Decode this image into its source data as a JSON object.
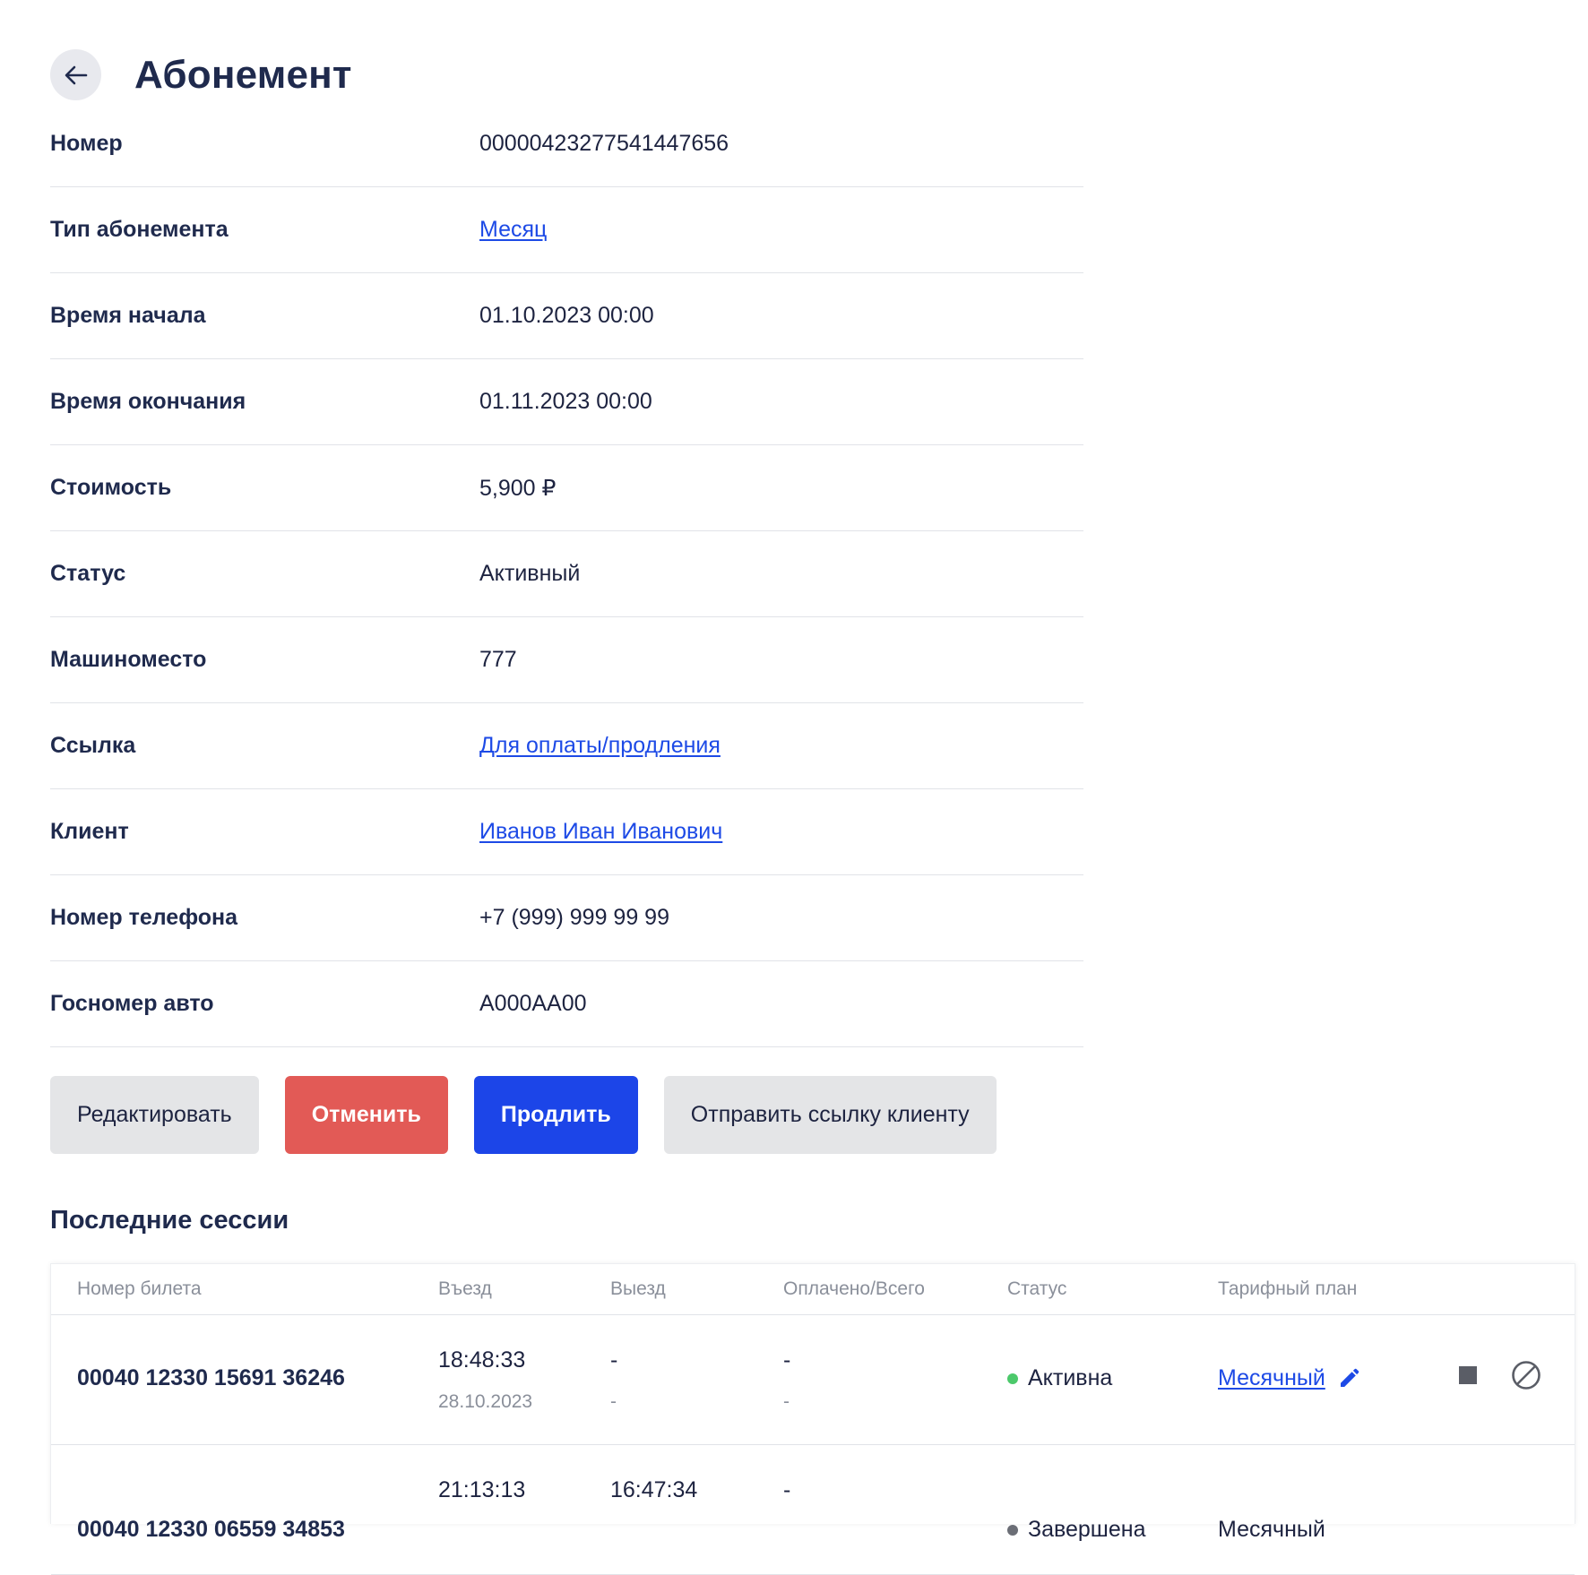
{
  "header": {
    "title": "Абонемент"
  },
  "details": [
    {
      "label": "Номер",
      "value": "00000423277541447656",
      "link": false
    },
    {
      "label": "Тип абонемента",
      "value": "Месяц",
      "link": true
    },
    {
      "label": "Время начала",
      "value": "01.10.2023 00:00",
      "link": false
    },
    {
      "label": "Время окончания",
      "value": "01.11.2023 00:00",
      "link": false
    },
    {
      "label": "Стоимость",
      "value": "5,900 ₽",
      "link": false
    },
    {
      "label": "Статус",
      "value": "Активный",
      "link": false
    },
    {
      "label": "Машиноместо",
      "value": "777",
      "link": false
    },
    {
      "label": "Ссылка",
      "value": "Для оплаты/продления",
      "link": true
    },
    {
      "label": "Клиент",
      "value": "Иванов Иван Иванович",
      "link": true
    },
    {
      "label": "Номер телефона",
      "value": "+7 (999) 999 99 99",
      "link": false
    },
    {
      "label": "Госномер авто",
      "value": "А000АА00",
      "link": false
    }
  ],
  "actions": {
    "edit": "Редактировать",
    "cancel": "Отменить",
    "extend": "Продлить",
    "send_link": "Отправить ссылку клиенту"
  },
  "sessions": {
    "title": "Последние сессии",
    "columns": [
      "Номер билета",
      "Въезд",
      "Выезд",
      "Оплачено/Всего",
      "Статус",
      "Тарифный план"
    ],
    "rows": [
      {
        "ticket": "00040 12330 15691 36246",
        "entry_time": "18:48:33",
        "entry_date": "28.10.2023",
        "exit_time": "-",
        "exit_date": "-",
        "paid": "-",
        "paid_sub": "-",
        "status": "Активна",
        "status_color": "#4cc96b",
        "plan": "Месячный",
        "plan_link": true
      },
      {
        "ticket": "00040 12330 06559 34853",
        "entry_time": "21:13:13",
        "entry_date": "",
        "exit_time": "16:47:34",
        "exit_date": "",
        "paid": "-",
        "paid_sub": "",
        "status": "Завершена",
        "status_color": "#6b6e76",
        "plan": "Месячный",
        "plan_link": false
      }
    ]
  },
  "colors": {
    "accent": "#1c45e8",
    "danger": "#e25a56",
    "link": "#1d4ae6"
  }
}
